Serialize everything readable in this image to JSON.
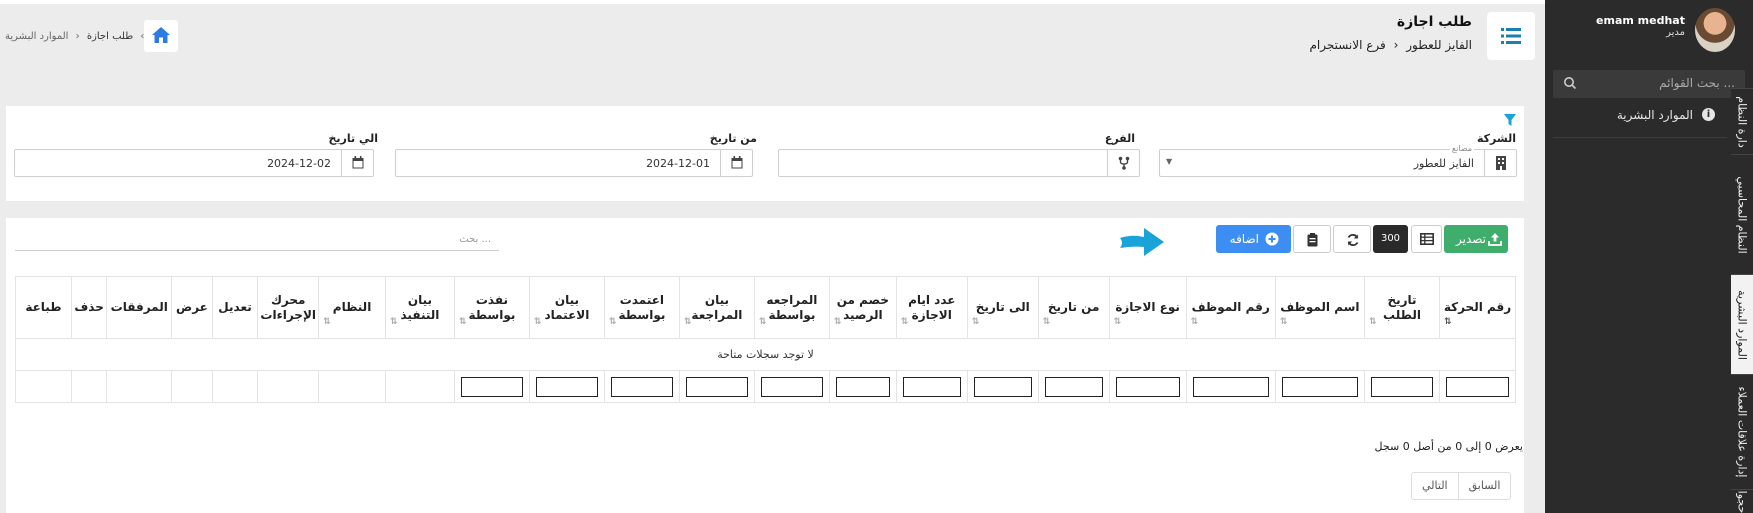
{
  "sidebar": {
    "user_name": "emam medhat",
    "user_role": "مدير",
    "search_placeholder": "بحث القوائم ...",
    "menu_item": "الموارد البشرية",
    "vertical_tabs": [
      "دارة النظام",
      "النظام المحاسبي",
      "الموارد البشرية",
      "إدارة علاقات العملاء",
      "حجوا"
    ]
  },
  "header": {
    "title": "طلب اجازة",
    "company": "الفايز للعطور",
    "branch": "فرع الانستجرام",
    "small_crumbs": [
      "طلب اجازة",
      "الموارد البشرية"
    ]
  },
  "filters": {
    "company_label": "الشركة",
    "company_tiny": "مصانع",
    "company_value": "الفايز للعطور",
    "branch_label": "الفرع",
    "branch_value": "",
    "from_label": "من تاريخ",
    "from_value": "2024-12-01",
    "to_label": "الي تاريخ",
    "to_value": "2024-12-02"
  },
  "toolbar": {
    "export_label": "تصدير",
    "page_size": "300",
    "add_label": "اضافه",
    "search_placeholder": "بحث ..."
  },
  "table": {
    "columns": [
      "رقم الحركة",
      "تاريخ الطلب",
      "اسم الموظف",
      "رقم الموظف",
      "نوع الاجازة",
      "من تاريخ",
      "الى تاريخ",
      "عدد ايام الاجازة",
      "خصم من الرصيد",
      "المراجعه بواسطة",
      "بيان المراجعة",
      "اعتمدت بواسطة",
      "بيان الاعتماد",
      "نفذت بواسطة",
      "بيان التنفيذ",
      "النظام",
      "محرك الإجراءات",
      "تعديل",
      "عرض",
      "المرفقات",
      "حذف",
      "طباعة"
    ],
    "empty_text": "لا توجد سجلات متاحة",
    "summary": "يعرض 0 إلى 0 من أصل 0 سجل"
  },
  "pagination": {
    "prev": "السابق",
    "next": "التالي"
  },
  "colors": {
    "export": "#3fae6d",
    "add": "#3d8ef2",
    "arrow": "#1aa3d9",
    "sidebar": "#2b2b2b"
  }
}
